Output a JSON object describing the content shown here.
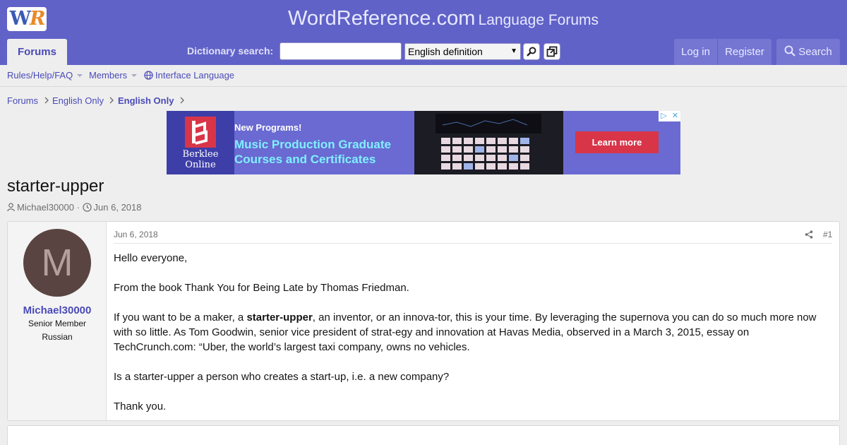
{
  "header": {
    "logo_text_w": "W",
    "logo_text_r": "R",
    "site_name": "WordReference.com",
    "site_subtitle": "Language Forums",
    "forums_tab": "Forums",
    "dictionary_label": "Dictionary search:",
    "dictionary_input_value": "",
    "dictionary_selected": "English definition",
    "login": "Log in",
    "register": "Register",
    "search": "Search"
  },
  "subnav": {
    "rules": "Rules/Help/FAQ",
    "members": "Members",
    "interface_language": "Interface Language"
  },
  "breadcrumb": [
    "Forums",
    "English Only",
    "English Only"
  ],
  "ad": {
    "logo_line1": "Berklee",
    "logo_line2": "Online",
    "kicker": "New Programs!",
    "headline_line1": "Music Production Graduate",
    "headline_line2": "Courses and Certificates",
    "cta": "Learn more"
  },
  "thread": {
    "title": "starter-upper",
    "author": "Michael30000",
    "separator": "·",
    "date": "Jun 6, 2018"
  },
  "post": {
    "avatar_letter": "M",
    "username": "Michael30000",
    "user_title": "Senior Member",
    "user_location": "Russian",
    "date": "Jun 6, 2018",
    "number": "#1",
    "p1": "Hello everyone,",
    "p2": "From the book Thank You for Being Late by Thomas Friedman.",
    "p3_before": "If you want to be a maker, a ",
    "p3_bold": "starter-upper",
    "p3_after": ", an inventor, or an innova-tor, this is your time. By leveraging the supernova you can do so much more now with so little. As Tom Goodwin, senior vice president of strat-egy and innovation at Havas Media, observed in a March 3, 2015, essay on TechCrunch.com: “Uber, the world’s largest taxi company, owns no vehicles.",
    "p4": "Is a starter-upper a person who creates a start-up, i.e. a new company?",
    "p5": "Thank you."
  },
  "colors": {
    "header_bg": "#6062c8",
    "link": "#4a4ab8",
    "ad_cta": "#d83548"
  }
}
